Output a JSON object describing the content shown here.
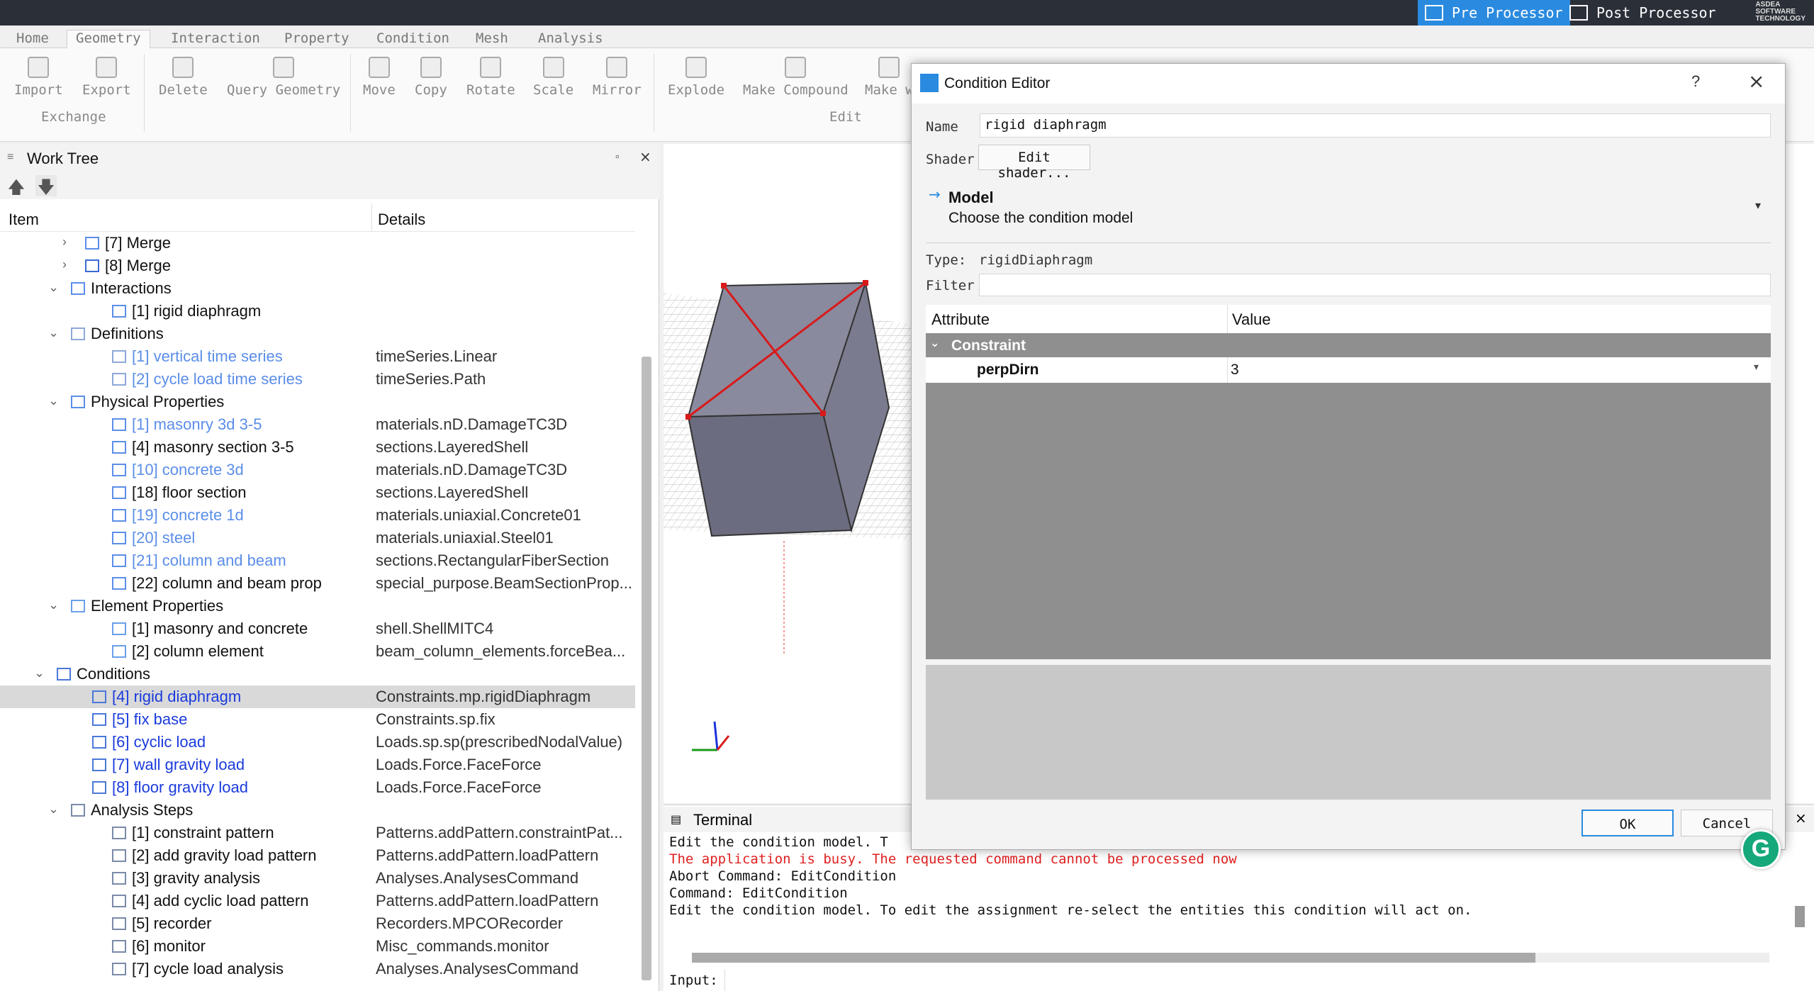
{
  "topbar": {
    "pre_processor": "Pre Processor",
    "post_processor": "Post Processor",
    "logo_line1": "ASDEA",
    "logo_line2": "SOFTWARE",
    "logo_line3": "TECHNOLOGY"
  },
  "ribbon": {
    "tabs": [
      "Home",
      "Geometry",
      "Interaction",
      "Property",
      "Condition",
      "Mesh",
      "Analysis"
    ],
    "active_tab": "Geometry",
    "buttons": {
      "import": "Import",
      "export": "Export",
      "delete": "Delete",
      "query_geometry": "Query Geometry",
      "move": "Move",
      "copy": "Copy",
      "rotate": "Rotate",
      "scale": "Scale",
      "mirror": "Mirror",
      "explode": "Explode",
      "make_compound": "Make Compound",
      "make": "Make w"
    },
    "groups": {
      "exchange": "Exchange",
      "edit": "Edit"
    }
  },
  "worktree": {
    "title": "Work Tree",
    "col_item": "Item",
    "col_details": "Details",
    "rows": [
      {
        "level": 2,
        "exp": "›",
        "icon": "merge-dot",
        "label": "[7] Merge",
        "details": "",
        "style": "normal"
      },
      {
        "level": 2,
        "exp": "›",
        "icon": "merge-grid",
        "label": "[8] Merge",
        "details": "",
        "style": "normal"
      },
      {
        "level": 1,
        "exp": "⌄",
        "icon": "interaction",
        "label": "Interactions",
        "details": "",
        "style": "normal"
      },
      {
        "level": 2,
        "exp": "",
        "icon": "interaction",
        "label": "[1] rigid diaphragm",
        "details": "",
        "style": "normal"
      },
      {
        "level": 1,
        "exp": "⌄",
        "icon": "list",
        "label": "Definitions",
        "details": "",
        "style": "normal"
      },
      {
        "level": 2,
        "exp": "",
        "icon": "list",
        "label": "[1] vertical time series",
        "details": "timeSeries.Linear",
        "style": "dim"
      },
      {
        "level": 2,
        "exp": "",
        "icon": "list",
        "label": "[2] cycle load time series",
        "details": "timeSeries.Path",
        "style": "dim"
      },
      {
        "level": 1,
        "exp": "⌄",
        "icon": "property",
        "label": "Physical Properties",
        "details": "",
        "style": "normal"
      },
      {
        "level": 2,
        "exp": "",
        "icon": "property",
        "label": "[1] masonry 3d 3-5",
        "details": "materials.nD.DamageTC3D",
        "style": "dim"
      },
      {
        "level": 2,
        "exp": "",
        "icon": "property",
        "label": "[4] masonry section 3-5",
        "details": "sections.LayeredShell",
        "style": "normal"
      },
      {
        "level": 2,
        "exp": "",
        "icon": "property",
        "label": "[10] concrete 3d",
        "details": "materials.nD.DamageTC3D",
        "style": "dim"
      },
      {
        "level": 2,
        "exp": "",
        "icon": "property",
        "label": "[18] floor section",
        "details": "sections.LayeredShell",
        "style": "normal"
      },
      {
        "level": 2,
        "exp": "",
        "icon": "property",
        "label": "[19] concrete 1d",
        "details": "materials.uniaxial.Concrete01",
        "style": "dim"
      },
      {
        "level": 2,
        "exp": "",
        "icon": "property",
        "label": "[20] steel",
        "details": "materials.uniaxial.Steel01",
        "style": "dim"
      },
      {
        "level": 2,
        "exp": "",
        "icon": "property",
        "label": "[21] column and beam",
        "details": "sections.RectangularFiberSection",
        "style": "dim"
      },
      {
        "level": 2,
        "exp": "",
        "icon": "property",
        "label": "[22] column and beam prop",
        "details": "special_purpose.BeamSectionProp...",
        "style": "normal"
      },
      {
        "level": 1,
        "exp": "⌄",
        "icon": "element",
        "label": "Element Properties",
        "details": "",
        "style": "normal"
      },
      {
        "level": 2,
        "exp": "",
        "icon": "element",
        "label": "[1] masonry and concrete",
        "details": "shell.ShellMITC4",
        "style": "normal"
      },
      {
        "level": 2,
        "exp": "",
        "icon": "element",
        "label": "[2] column element",
        "details": "beam_column_elements.forceBea...",
        "style": "normal"
      },
      {
        "level": 0,
        "exp": "⌄",
        "icon": "condition",
        "label": "Conditions",
        "details": "",
        "style": "normal"
      },
      {
        "level": 1,
        "exp": "",
        "icon": "condition",
        "label": "[4] rigid diaphragm",
        "details": "Constraints.mp.rigidDiaphragm",
        "style": "blue",
        "selected": true
      },
      {
        "level": 1,
        "exp": "",
        "icon": "condition",
        "label": "[5] fix base",
        "details": "Constraints.sp.fix",
        "style": "blue"
      },
      {
        "level": 1,
        "exp": "",
        "icon": "condition",
        "label": "[6] cyclic load",
        "details": "Loads.sp.sp(prescribedNodalValue)",
        "style": "blue"
      },
      {
        "level": 1,
        "exp": "",
        "icon": "condition",
        "label": "[7] wall gravity load",
        "details": "Loads.Force.FaceForce",
        "style": "blue"
      },
      {
        "level": 1,
        "exp": "",
        "icon": "condition",
        "label": "[8] floor gravity load",
        "details": "Loads.Force.FaceForce",
        "style": "blue"
      },
      {
        "level": 1,
        "exp": "⌄",
        "icon": "step",
        "label": "Analysis Steps",
        "details": "",
        "style": "normal"
      },
      {
        "level": 2,
        "exp": "",
        "icon": "step",
        "label": "[1] constraint pattern",
        "details": "Patterns.addPattern.constraintPat...",
        "style": "normal"
      },
      {
        "level": 2,
        "exp": "",
        "icon": "step",
        "label": "[2] add gravity load pattern",
        "details": "Patterns.addPattern.loadPattern",
        "style": "normal"
      },
      {
        "level": 2,
        "exp": "",
        "icon": "step",
        "label": "[3] gravity analysis",
        "details": "Analyses.AnalysesCommand",
        "style": "normal"
      },
      {
        "level": 2,
        "exp": "",
        "icon": "step",
        "label": "[4] add cyclic load pattern",
        "details": "Patterns.addPattern.loadPattern",
        "style": "normal"
      },
      {
        "level": 2,
        "exp": "",
        "icon": "step",
        "label": "[5] recorder",
        "details": "Recorders.MPCORecorder",
        "style": "normal"
      },
      {
        "level": 2,
        "exp": "",
        "icon": "step",
        "label": "[6] monitor",
        "details": "Misc_commands.monitor",
        "style": "normal"
      },
      {
        "level": 2,
        "exp": "",
        "icon": "step",
        "label": "[7] cycle load analysis",
        "details": "Analyses.AnalysesCommand",
        "style": "normal"
      }
    ]
  },
  "terminal": {
    "title": "Terminal",
    "lines": [
      {
        "text": "Edit the condition model. T",
        "color": "normal"
      },
      {
        "text": "The application is busy. The requested command cannot be processed now",
        "color": "red"
      },
      {
        "text": "Abort Command: EditCondition",
        "color": "normal"
      },
      {
        "text": "Command: EditCondition",
        "color": "normal"
      },
      {
        "text": "Edit the condition model. To edit the assignment re-select the entities this condition will act on.",
        "color": "normal"
      }
    ],
    "input_label": "Input:"
  },
  "dialog": {
    "title": "Condition Editor",
    "help": "?",
    "name_label": "Name",
    "name_value": "rigid diaphragm",
    "shader_label": "Shader",
    "shader_button": "Edit shader...",
    "model_title": "Model",
    "model_desc": "Choose the condition model",
    "type_label": "Type:",
    "type_value": "rigidDiaphragm",
    "filter_label": "Filter",
    "filter_value": "",
    "col_attribute": "Attribute",
    "col_value": "Value",
    "group": "Constraint",
    "attr_name": "perpDirn",
    "attr_value": "3",
    "ok": "OK",
    "cancel": "Cancel"
  },
  "colors": {
    "accent": "#2a8ae0",
    "link_blue": "#1a3bdc",
    "dim_blue": "#5b8ee8",
    "error_red": "#e02020",
    "table_gray": "#8f8f8f"
  }
}
